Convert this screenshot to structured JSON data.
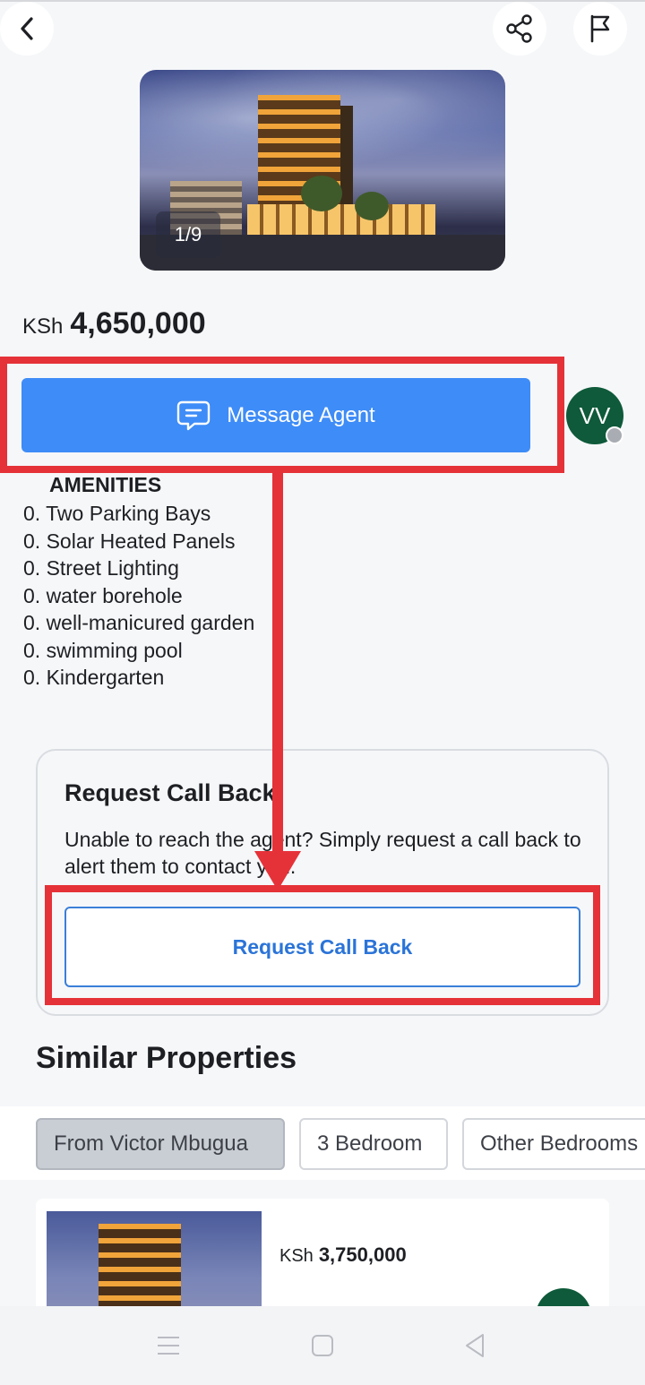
{
  "header": {
    "back_icon": "chevron-left-icon",
    "share_icon": "share-icon",
    "report_icon": "flag-icon"
  },
  "gallery": {
    "counter": "1/9"
  },
  "listing": {
    "currency": "KSh",
    "price": "4,650,000"
  },
  "contact": {
    "message_label": "Message Agent",
    "message_icon": "chat-bubble-icon",
    "agent_initials": "VV"
  },
  "amenities": {
    "title": "AMENITIES",
    "items": [
      "0. Two Parking Bays",
      "0. Solar Heated Panels",
      "0. Street Lighting",
      "0. water borehole",
      "0. well-manicured garden",
      "0. swimming pool",
      "0. Kindergarten"
    ]
  },
  "callback": {
    "title": "Request Call Back",
    "text": "Unable to reach the agent? Simply request a call back to alert them to contact you.",
    "button_label": "Request Call Back"
  },
  "similar": {
    "title": "Similar Properties",
    "filters": [
      "From Victor Mbugua",
      "3 Bedroom",
      "Other Bedrooms"
    ],
    "active_filter": "From Victor Mbugua",
    "first_item": {
      "currency": "KSh",
      "price": "3,750,000"
    }
  },
  "colors": {
    "primary": "#3e8cf7",
    "agent": "#0e5a3a",
    "annotation": "#e53238",
    "link": "#2b74d8"
  }
}
